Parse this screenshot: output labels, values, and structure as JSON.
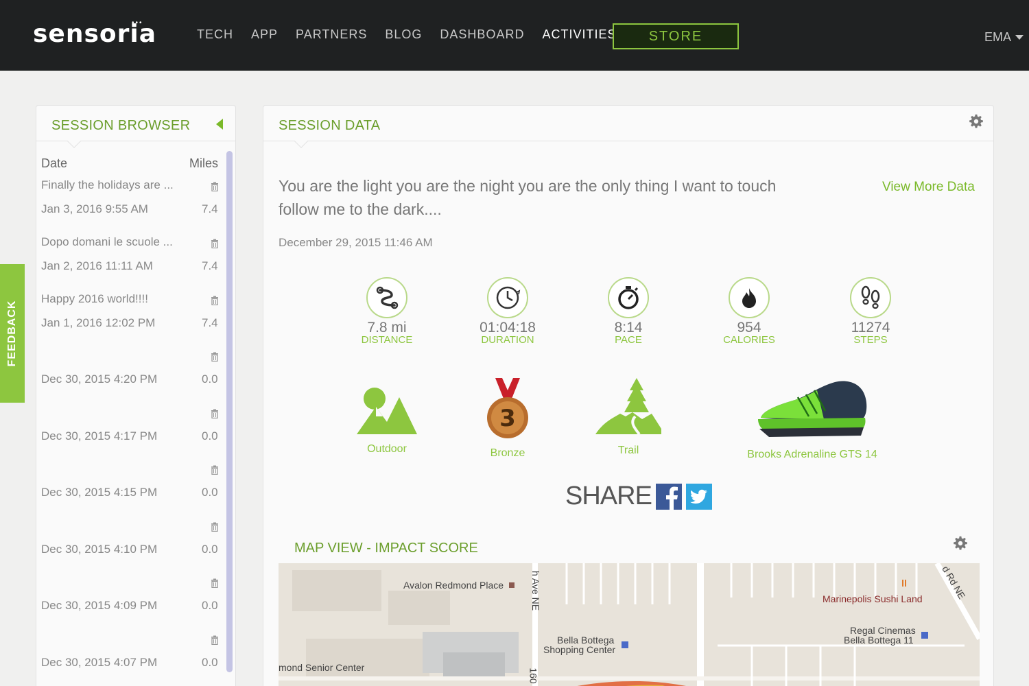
{
  "nav": {
    "logo": "sensoria",
    "logo_mark": "•••",
    "items": [
      {
        "label": "TECH"
      },
      {
        "label": "APP"
      },
      {
        "label": "PARTNERS"
      },
      {
        "label": "BLOG"
      },
      {
        "label": "DASHBOARD"
      },
      {
        "label": "ACTIVITIES"
      }
    ],
    "store": "STORE",
    "user": "EMA"
  },
  "feedback": "FEEDBACK",
  "browser": {
    "title": "SESSION BROWSER",
    "col_date": "Date",
    "col_miles": "Miles",
    "sessions": [
      {
        "title": "Finally the holidays are ...",
        "date": "Jan 3, 2016 9:55 AM",
        "miles": "7.4"
      },
      {
        "title": "Dopo domani le scuole ...",
        "date": "Jan 2, 2016 11:11 AM",
        "miles": "7.4"
      },
      {
        "title": "Happy 2016 world!!!!",
        "date": "Jan 1, 2016 12:02 PM",
        "miles": "7.4"
      },
      {
        "title": "",
        "date": "Dec 30, 2015 4:20 PM",
        "miles": "0.0"
      },
      {
        "title": "",
        "date": "Dec 30, 2015 4:17 PM",
        "miles": "0.0"
      },
      {
        "title": "",
        "date": "Dec 30, 2015 4:15 PM",
        "miles": "0.0"
      },
      {
        "title": "",
        "date": "Dec 30, 2015 4:10 PM",
        "miles": "0.0"
      },
      {
        "title": "",
        "date": "Dec 30, 2015 4:09 PM",
        "miles": "0.0"
      },
      {
        "title": "",
        "date": "Dec 30, 2015 4:07 PM",
        "miles": "0.0"
      }
    ]
  },
  "data": {
    "title": "SESSION DATA",
    "description": "You are the light you are the night you are the only thing I want to touch follow me to the dark....",
    "view_more": "View More Data",
    "date": "December 29, 2015 11:46 AM",
    "stats": [
      {
        "value": "7.8 mi",
        "label": "DISTANCE",
        "icon": "route-icon"
      },
      {
        "value": "01:04:18",
        "label": "DURATION",
        "icon": "clock-icon"
      },
      {
        "value": "8:14",
        "label": "PACE",
        "icon": "stopwatch-icon"
      },
      {
        "value": "954",
        "label": "CALORIES",
        "icon": "flame-icon"
      },
      {
        "value": "11274",
        "label": "STEPS",
        "icon": "footprints-icon"
      }
    ],
    "badges": {
      "outdoor": "Outdoor",
      "bronze": "Bronze",
      "bronze_rank": "3",
      "trail": "Trail",
      "shoe": "Brooks Adrenaline GTS 14"
    },
    "share": "SHARE",
    "map_title": "MAP VIEW - IMPACT SCORE",
    "map_labels": {
      "avalon": "Avalon Redmond Place",
      "bella1": "Bella Bottega",
      "bella2": "Shopping Center",
      "senior": "mond Senior Center",
      "sushi": "Marinepolis Sushi Land",
      "regal1": "Regal Cinemas",
      "regal2": "Bella Bottega 11",
      "ave": "h Ave NE",
      "rd": "d Rd NE",
      "num": "160"
    }
  },
  "colors": {
    "accent": "#8dc63f",
    "title_green": "#6b9e2c",
    "nav_bg": "#1f2122"
  }
}
